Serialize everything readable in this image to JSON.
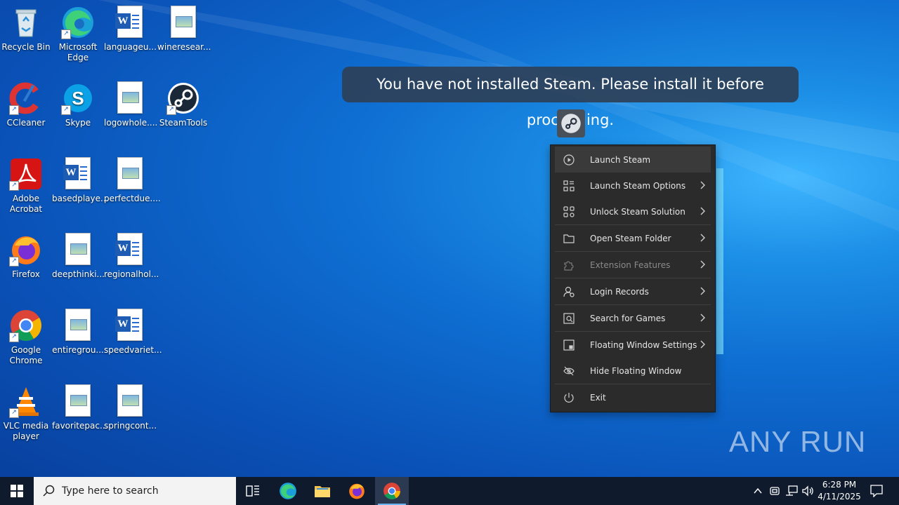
{
  "desktop": {
    "icons": [
      {
        "label": "Recycle Bin",
        "icon": "recycle-bin-icon"
      },
      {
        "label": "Microsoft Edge",
        "icon": "edge-icon"
      },
      {
        "label": "languageu...",
        "icon": "word-doc-icon"
      },
      {
        "label": "wineresear...",
        "icon": "image-file-icon"
      },
      {
        "label": "CCleaner",
        "icon": "ccleaner-icon"
      },
      {
        "label": "Skype",
        "icon": "skype-icon"
      },
      {
        "label": "logowhole....",
        "icon": "image-file-icon"
      },
      {
        "label": "SteamTools",
        "icon": "steam-icon"
      },
      {
        "label": "Adobe Acrobat",
        "icon": "acrobat-icon"
      },
      {
        "label": "basedplaye...",
        "icon": "word-doc-icon"
      },
      {
        "label": "perfectdue....",
        "icon": "image-file-icon"
      },
      {
        "label": "Firefox",
        "icon": "firefox-icon"
      },
      {
        "label": "deepthinki...",
        "icon": "image-file-icon"
      },
      {
        "label": "regionalhol...",
        "icon": "word-doc-icon"
      },
      {
        "label": "Google Chrome",
        "icon": "chrome-icon"
      },
      {
        "label": "entiregrou...",
        "icon": "image-file-icon"
      },
      {
        "label": "speedvariet...",
        "icon": "word-doc-icon"
      },
      {
        "label": "VLC media player",
        "icon": "vlc-icon"
      },
      {
        "label": "favoritepac...",
        "icon": "image-file-icon"
      },
      {
        "label": "springcont...",
        "icon": "image-file-icon"
      }
    ]
  },
  "toast": {
    "message": "You have not installed Steam. Please install it before proceeding."
  },
  "menu": {
    "items": [
      {
        "label": "Launch Steam",
        "icon": "play-circle-icon",
        "submenu": false,
        "disabled": false
      },
      {
        "label": "Launch Steam Options",
        "icon": "options-grid-icon",
        "submenu": true,
        "disabled": false
      },
      {
        "label": "Unlock Steam Solution",
        "icon": "unlock-grid-icon",
        "submenu": true,
        "disabled": false
      },
      {
        "label": "Open Steam Folder",
        "icon": "folder-icon",
        "submenu": true,
        "disabled": false
      },
      {
        "label": "Extension Features",
        "icon": "puzzle-icon",
        "submenu": true,
        "disabled": true
      },
      {
        "label": "Login Records",
        "icon": "user-records-icon",
        "submenu": true,
        "disabled": false
      },
      {
        "label": "Search for Games",
        "icon": "search-games-icon",
        "submenu": true,
        "disabled": false
      },
      {
        "label": "Floating Window Settings",
        "icon": "window-settings-icon",
        "submenu": true,
        "disabled": false
      },
      {
        "label": "Hide Floating Window",
        "icon": "eye-off-icon",
        "submenu": false,
        "disabled": false
      },
      {
        "label": "Exit",
        "icon": "power-icon",
        "submenu": false,
        "disabled": false
      }
    ]
  },
  "watermark": {
    "text": "ANY RUN"
  },
  "taskbar": {
    "search_placeholder": "Type here to search",
    "clock_time": "6:28 PM",
    "clock_date": "4/11/2025"
  }
}
